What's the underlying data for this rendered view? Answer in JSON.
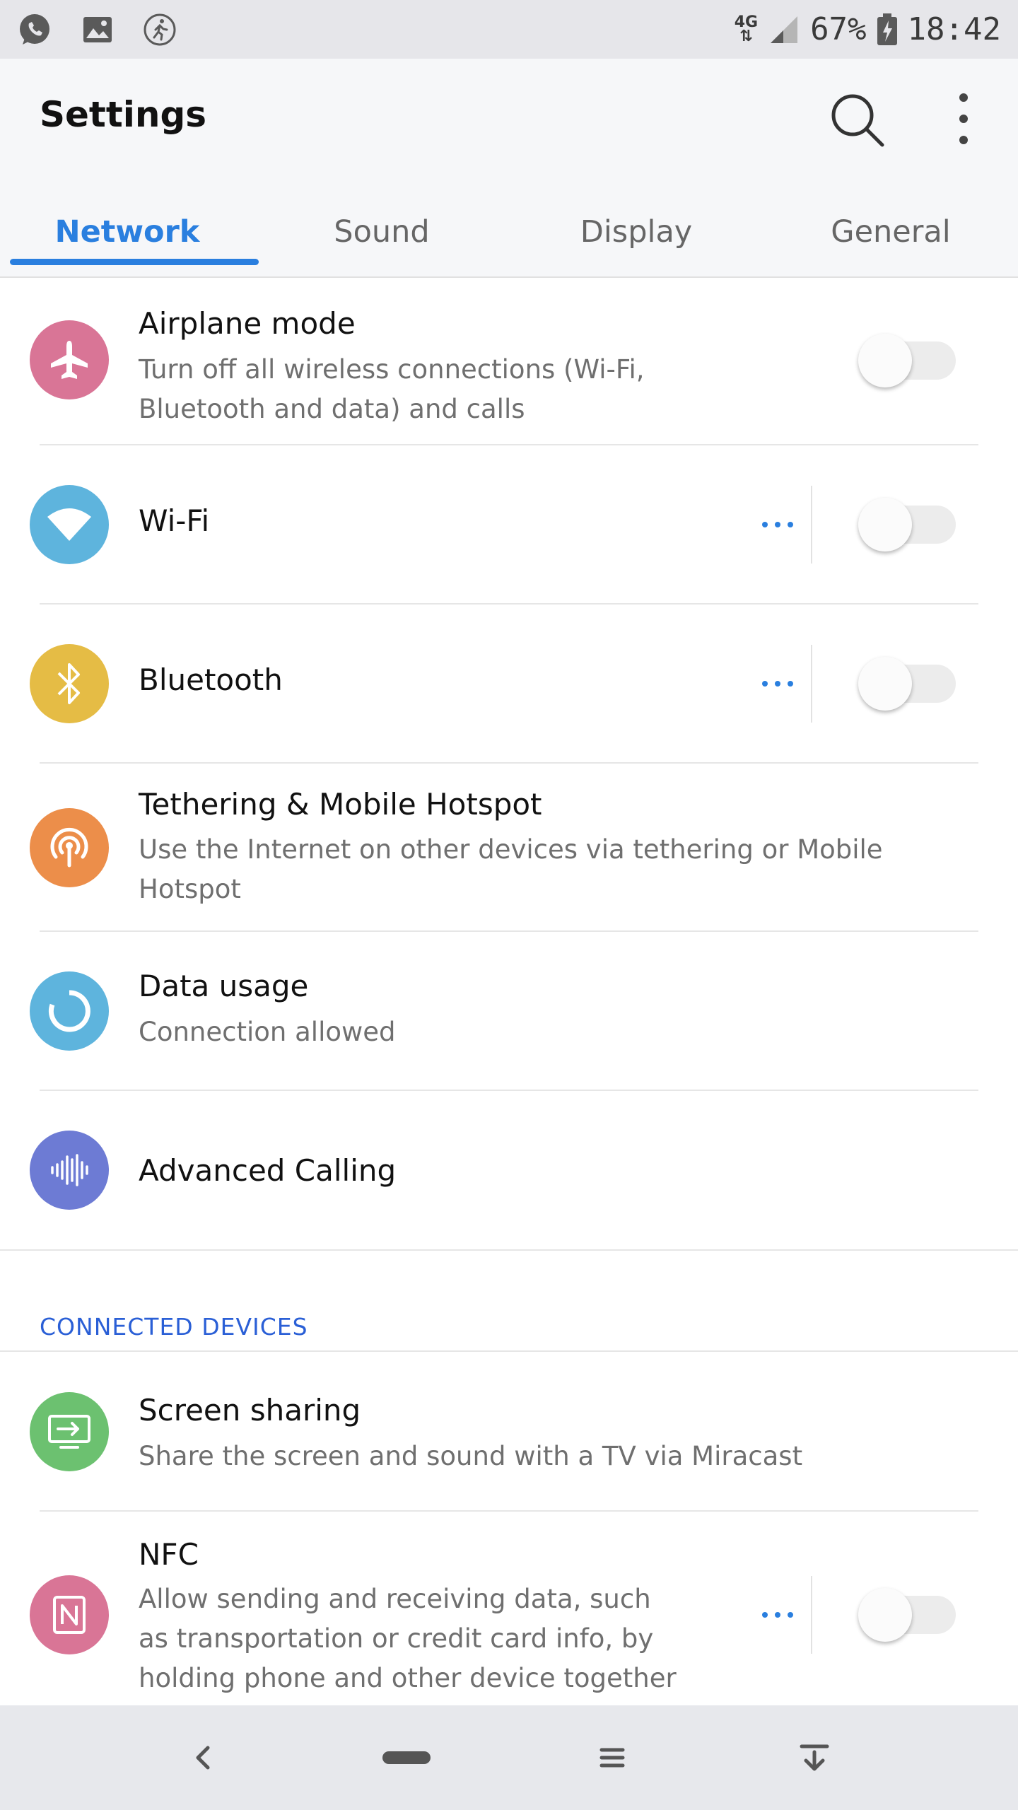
{
  "status_bar": {
    "network_type": "4G",
    "battery": "67%",
    "time": "18:42",
    "left_icons": [
      "whatsapp-icon",
      "image-icon",
      "running-icon"
    ]
  },
  "app_bar": {
    "title": "Settings",
    "tabs": [
      {
        "label": "Network",
        "active": true
      },
      {
        "label": "Sound",
        "active": false
      },
      {
        "label": "Display",
        "active": false
      },
      {
        "label": "General",
        "active": false
      }
    ],
    "accent_color": "#2a7fdf"
  },
  "network": {
    "airplane": {
      "title": "Airplane mode",
      "subtitle_line1": "Turn off all wireless connections (Wi-Fi,",
      "subtitle_line2": "Bluetooth and data) and calls",
      "enabled": false,
      "icon": "airplane-icon",
      "color": "#d97596"
    },
    "wifi": {
      "title": "Wi-Fi",
      "enabled": false,
      "icon": "wifi-icon",
      "color": "#5eb4dd"
    },
    "bluetooth": {
      "title": "Bluetooth",
      "enabled": false,
      "icon": "bluetooth-icon",
      "color": "#e5bc45"
    },
    "tethering": {
      "title": "Tethering & Mobile Hotspot",
      "subtitle_line1": "Use the Internet on other devices via tethering or Mobile",
      "subtitle_line2": "Hotspot",
      "icon": "hotspot-icon",
      "color": "#ec8e4a"
    },
    "data_usage": {
      "title": "Data usage",
      "subtitle": "Connection allowed",
      "icon": "data-usage-icon",
      "color": "#5eb4dd"
    },
    "advanced_calling": {
      "title": "Advanced Calling",
      "icon": "advanced-calling-icon",
      "color": "#6d7bd4"
    }
  },
  "connected_devices": {
    "header": "CONNECTED DEVICES",
    "header_color": "#2a5fd6",
    "screen_sharing": {
      "title": "Screen sharing",
      "subtitle": "Share the screen and sound with a TV via Miracast",
      "icon": "screen-sharing-icon",
      "color": "#6cc170"
    },
    "nfc": {
      "title": "NFC",
      "subtitle_line1": "Allow sending and receiving data, such",
      "subtitle_line2": "as transportation or credit card info, by",
      "subtitle_line3": "holding phone and other device together",
      "enabled": false,
      "icon": "nfc-icon",
      "color": "#d97596"
    }
  },
  "nav_bar": {
    "buttons": [
      "back-icon",
      "home-icon",
      "menu-icon",
      "notification-pull-icon"
    ]
  }
}
